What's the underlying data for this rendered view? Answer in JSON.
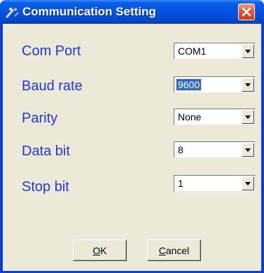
{
  "window": {
    "title": "Communication Setting",
    "icon": "tools-icon",
    "close_icon": "close-icon"
  },
  "fields": [
    {
      "label": "Com Port",
      "value": "COM1"
    },
    {
      "label": "Baud rate",
      "value": "9600"
    },
    {
      "label": "Parity",
      "value": "None"
    },
    {
      "label": "Data bit",
      "value": "8"
    },
    {
      "label": "Stop bit",
      "value": "1"
    }
  ],
  "buttons": {
    "ok": {
      "mnemonic": "O",
      "rest": "K"
    },
    "cancel": {
      "mnemonic": "C",
      "rest": "ancel"
    }
  }
}
